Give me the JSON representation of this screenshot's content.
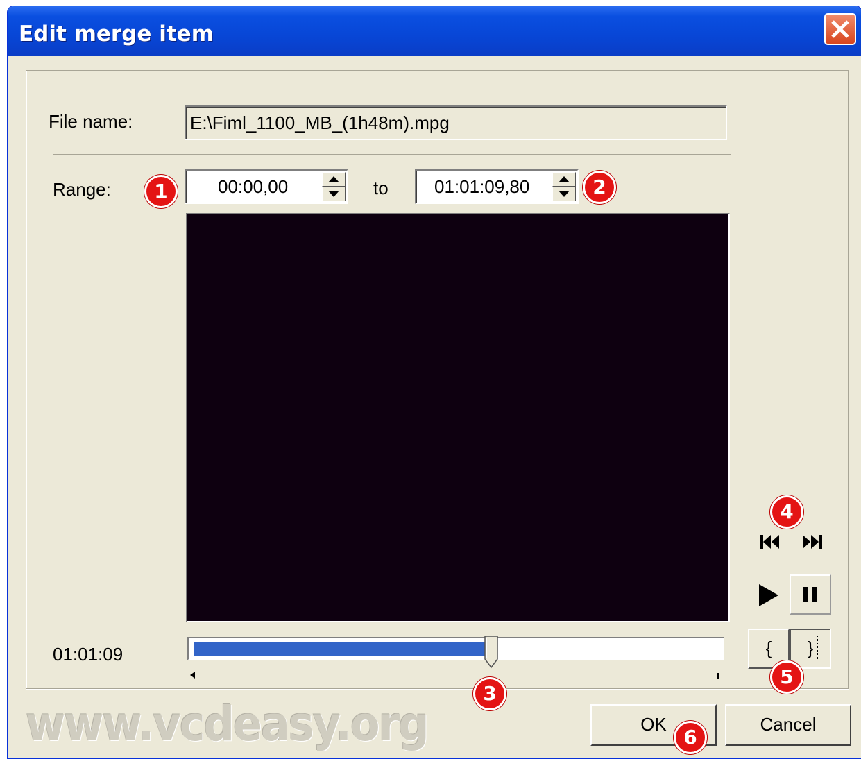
{
  "window": {
    "title": "Edit merge item"
  },
  "file": {
    "label": "File name:",
    "value": "E:\\Fiml_1100_MB_(1h48m).mpg"
  },
  "range": {
    "label": "Range:",
    "start": "00:00,00",
    "to_label": "to",
    "end": "01:01:09,80"
  },
  "timeline": {
    "current_time": "01:01:09",
    "position_fraction": 0.56
  },
  "controls": {
    "mark_in_label": "{",
    "mark_out_label": "}"
  },
  "buttons": {
    "ok": "OK",
    "cancel": "Cancel"
  },
  "badges": [
    "1",
    "2",
    "3",
    "4",
    "5",
    "6"
  ],
  "watermark": "www.vcdeasy.org",
  "colors": {
    "title_bar": "#0a4fe0",
    "badge": "#e41414",
    "progress": "#3264c8",
    "video": "#0e0010"
  }
}
